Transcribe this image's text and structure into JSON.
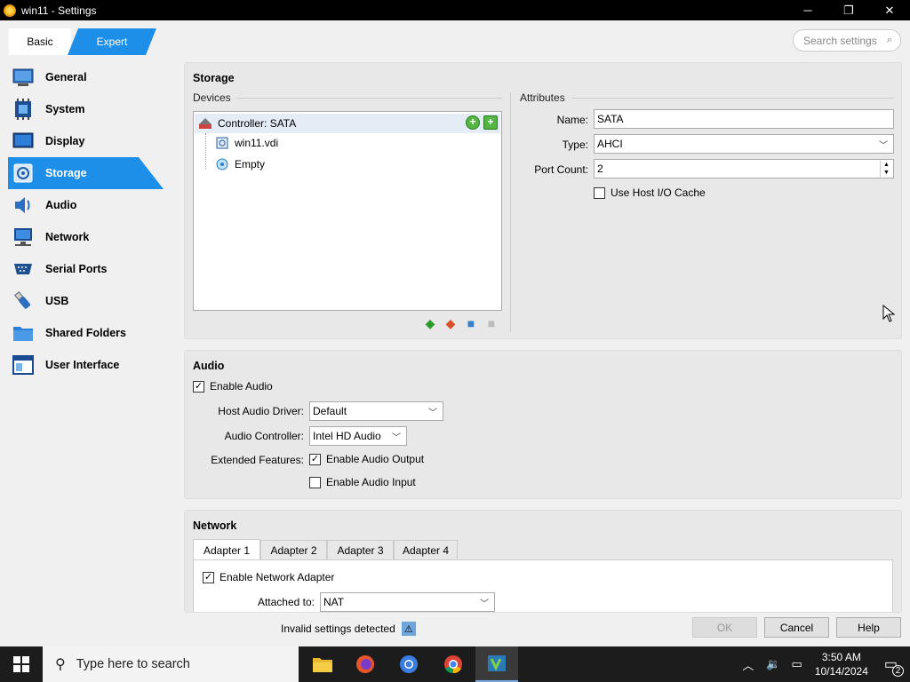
{
  "window": {
    "title": "win11 - Settings",
    "minimize": "─",
    "maximize": "❐",
    "close": "✕"
  },
  "mode": {
    "basic": "Basic",
    "expert": "Expert"
  },
  "search": {
    "placeholder": "Search settings"
  },
  "sidebar": {
    "items": [
      {
        "label": "General",
        "icon": "general-icon"
      },
      {
        "label": "System",
        "icon": "system-icon"
      },
      {
        "label": "Display",
        "icon": "display-icon"
      },
      {
        "label": "Storage",
        "icon": "storage-icon",
        "selected": true
      },
      {
        "label": "Audio",
        "icon": "audio-icon"
      },
      {
        "label": "Network",
        "icon": "network-icon"
      },
      {
        "label": "Serial Ports",
        "icon": "serial-ports-icon"
      },
      {
        "label": "USB",
        "icon": "usb-icon"
      },
      {
        "label": "Shared Folders",
        "icon": "shared-folders-icon"
      },
      {
        "label": "User Interface",
        "icon": "user-interface-icon"
      }
    ]
  },
  "storage": {
    "title": "Storage",
    "devices_label": "Devices",
    "attributes_label": "Attributes",
    "tree": {
      "controller": "Controller: SATA",
      "items": [
        "win11.vdi",
        "Empty"
      ]
    },
    "attributes": {
      "name_label": "Name:",
      "name_value": "SATA",
      "type_label": "Type:",
      "type_value": "AHCI",
      "port_count_label": "Port Count:",
      "port_count_value": "2",
      "host_io_cache_label": "Use Host I/O Cache",
      "host_io_cache_checked": false
    }
  },
  "audio": {
    "title": "Audio",
    "enable_label": "Enable Audio",
    "enable_checked": true,
    "driver_label": "Host Audio Driver:",
    "driver_value": "Default",
    "controller_label": "Audio Controller:",
    "controller_value": "Intel HD Audio",
    "extended_label": "Extended Features:",
    "output_label": "Enable Audio Output",
    "output_checked": true,
    "input_label": "Enable Audio Input",
    "input_checked": false
  },
  "network": {
    "title": "Network",
    "tabs": [
      "Adapter 1",
      "Adapter 2",
      "Adapter 3",
      "Adapter 4"
    ],
    "active_tab": 0,
    "enable_label": "Enable Network Adapter",
    "enable_checked": true,
    "attached_label": "Attached to:",
    "attached_value": "NAT"
  },
  "footer": {
    "invalid_text": "Invalid settings detected",
    "ok": "OK",
    "cancel": "Cancel",
    "help": "Help"
  },
  "taskbar": {
    "search_placeholder": "Type here to search",
    "time": "3:50 AM",
    "date": "10/14/2024",
    "notification_count": "2"
  },
  "colors": {
    "accent": "#1e8fe8",
    "panel": "#e8e8e8",
    "taskbar": "#1c1c1c"
  }
}
